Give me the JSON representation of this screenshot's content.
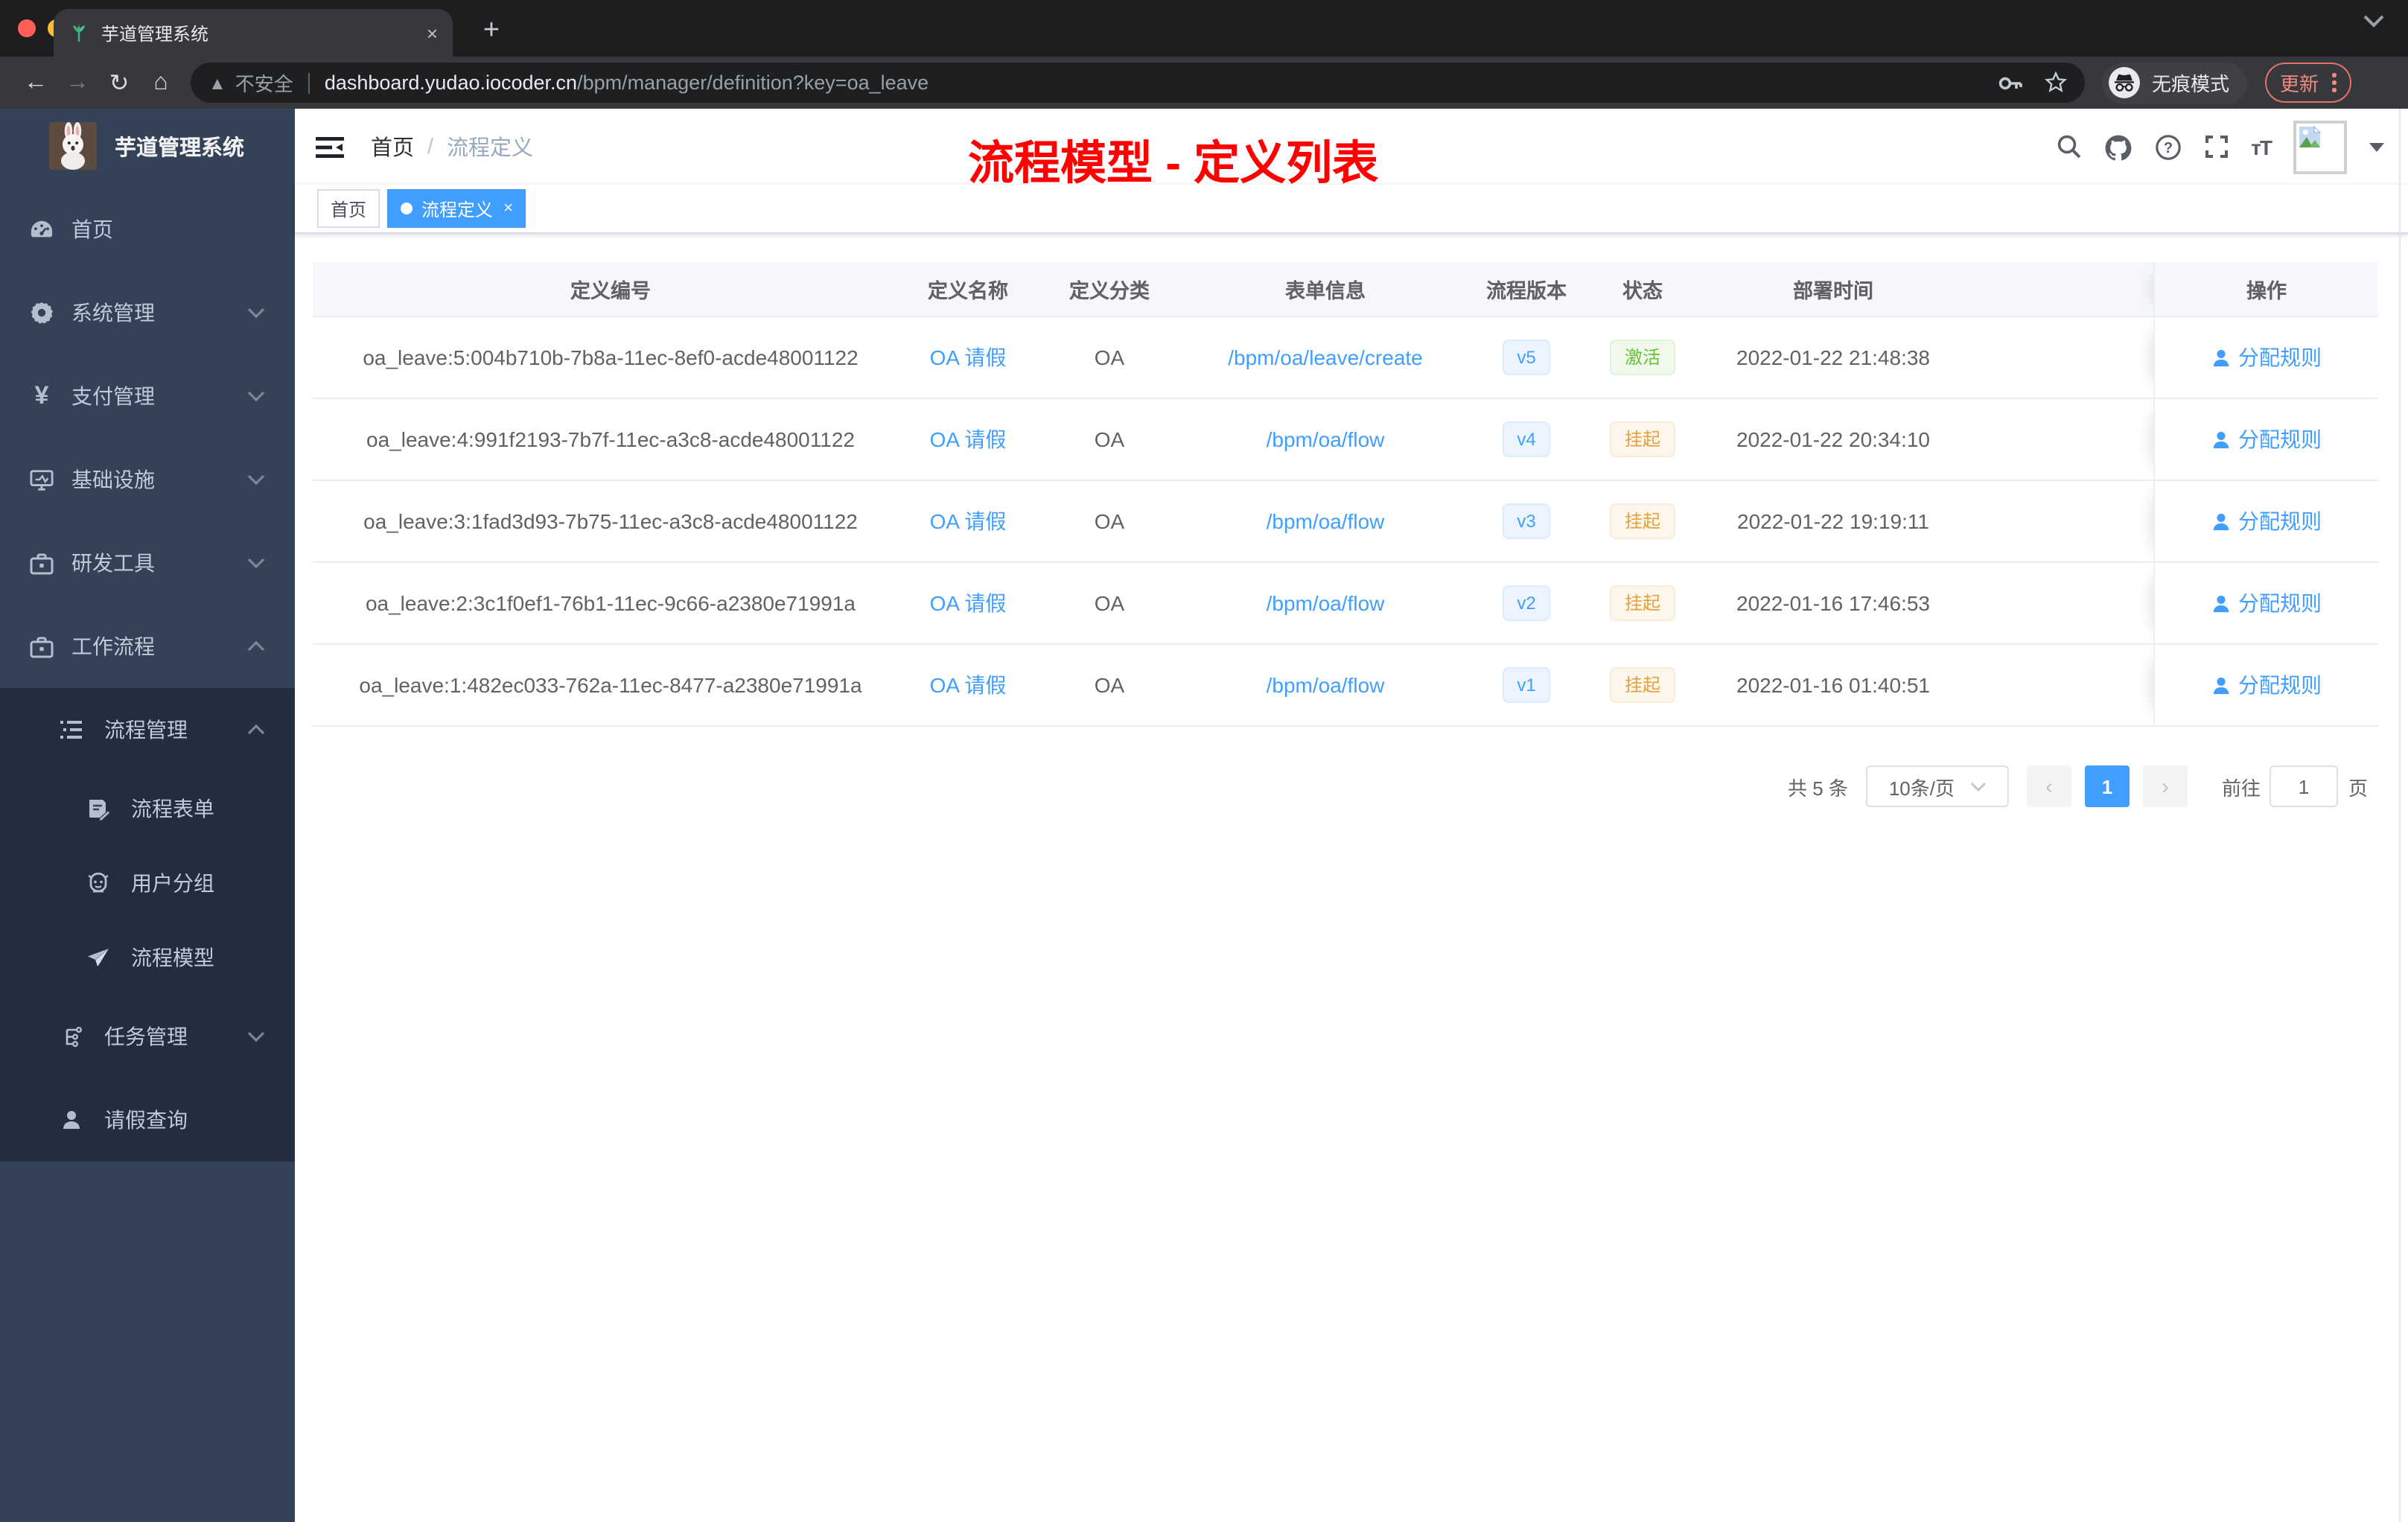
{
  "browser": {
    "tab": {
      "title": "芋道管理系统",
      "close_label": "×"
    },
    "new_tab_label": "+",
    "security_label": "不安全",
    "url_domain": "dashboard.yudao.iocoder.cn",
    "url_path": "/bpm/manager/definition?key=oa_leave",
    "incognito_label": "无痕模式",
    "update_label": "更新",
    "traffic_lights": [
      "#ff5f57",
      "#febc2e",
      "#28c840"
    ]
  },
  "sidebar": {
    "logo_title": "芋道管理系统",
    "items": [
      {
        "label": "首页",
        "icon": "dashboard-icon"
      },
      {
        "label": "系统管理",
        "icon": "gear-icon"
      },
      {
        "label": "支付管理",
        "icon": "yen-icon"
      },
      {
        "label": "基础设施",
        "icon": "monitor-icon"
      },
      {
        "label": "研发工具",
        "icon": "toolbox-icon"
      },
      {
        "label": "工作流程",
        "icon": "briefcase-icon"
      },
      {
        "label": "流程管理",
        "icon": "list-tree-icon"
      },
      {
        "label": "流程表单",
        "icon": "form-doc-icon"
      },
      {
        "label": "用户分组",
        "icon": "robot-icon"
      },
      {
        "label": "流程模型",
        "icon": "paper-plane-icon"
      },
      {
        "label": "任务管理",
        "icon": "task-tree-icon"
      },
      {
        "label": "请假查询",
        "icon": "user-icon"
      }
    ]
  },
  "header": {
    "breadcrumb": {
      "home": "首页",
      "sep": "/",
      "current": "流程定义"
    },
    "annotation": "流程模型 - 定义列表",
    "annotation_color": "#ff0000"
  },
  "tags": {
    "home": "首页",
    "active": "流程定义",
    "close_label": "×"
  },
  "table": {
    "columns": [
      "定义编号",
      "定义名称",
      "定义分类",
      "表单信息",
      "流程版本",
      "状态",
      "部署时间",
      "操作"
    ],
    "action_label": "分配规则",
    "rows": [
      {
        "id": "oa_leave:5:004b710b-7b8a-11ec-8ef0-acde48001122",
        "name": "OA 请假",
        "category": "OA",
        "form": "/bpm/oa/leave/create",
        "version": "v5",
        "status": "激活",
        "deploy_time": "2022-01-22 21:48:38"
      },
      {
        "id": "oa_leave:4:991f2193-7b7f-11ec-a3c8-acde48001122",
        "name": "OA 请假",
        "category": "OA",
        "form": "/bpm/oa/flow",
        "version": "v4",
        "status": "挂起",
        "deploy_time": "2022-01-22 20:34:10"
      },
      {
        "id": "oa_leave:3:1fad3d93-7b75-11ec-a3c8-acde48001122",
        "name": "OA 请假",
        "category": "OA",
        "form": "/bpm/oa/flow",
        "version": "v3",
        "status": "挂起",
        "deploy_time": "2022-01-22 19:19:11"
      },
      {
        "id": "oa_leave:2:3c1f0ef1-76b1-11ec-9c66-a2380e71991a",
        "name": "OA 请假",
        "category": "OA",
        "form": "/bpm/oa/flow",
        "version": "v2",
        "status": "挂起",
        "deploy_time": "2022-01-16 17:46:53"
      },
      {
        "id": "oa_leave:1:482ec033-762a-11ec-8477-a2380e71991a",
        "name": "OA 请假",
        "category": "OA",
        "form": "/bpm/oa/flow",
        "version": "v1",
        "status": "挂起",
        "deploy_time": "2022-01-16 01:40:51"
      }
    ]
  },
  "pagination": {
    "total": "共 5 条",
    "page_size": "10条/页",
    "prev": "‹",
    "current": "1",
    "next": "›",
    "goto": "前往",
    "goto_value": "1",
    "unit": "页"
  },
  "colors": {
    "accent": "#409eff",
    "success": "#67c23a",
    "warning": "#e6a23c",
    "sidebar_bg": "#344257",
    "submenu_bg": "#222d3d"
  }
}
